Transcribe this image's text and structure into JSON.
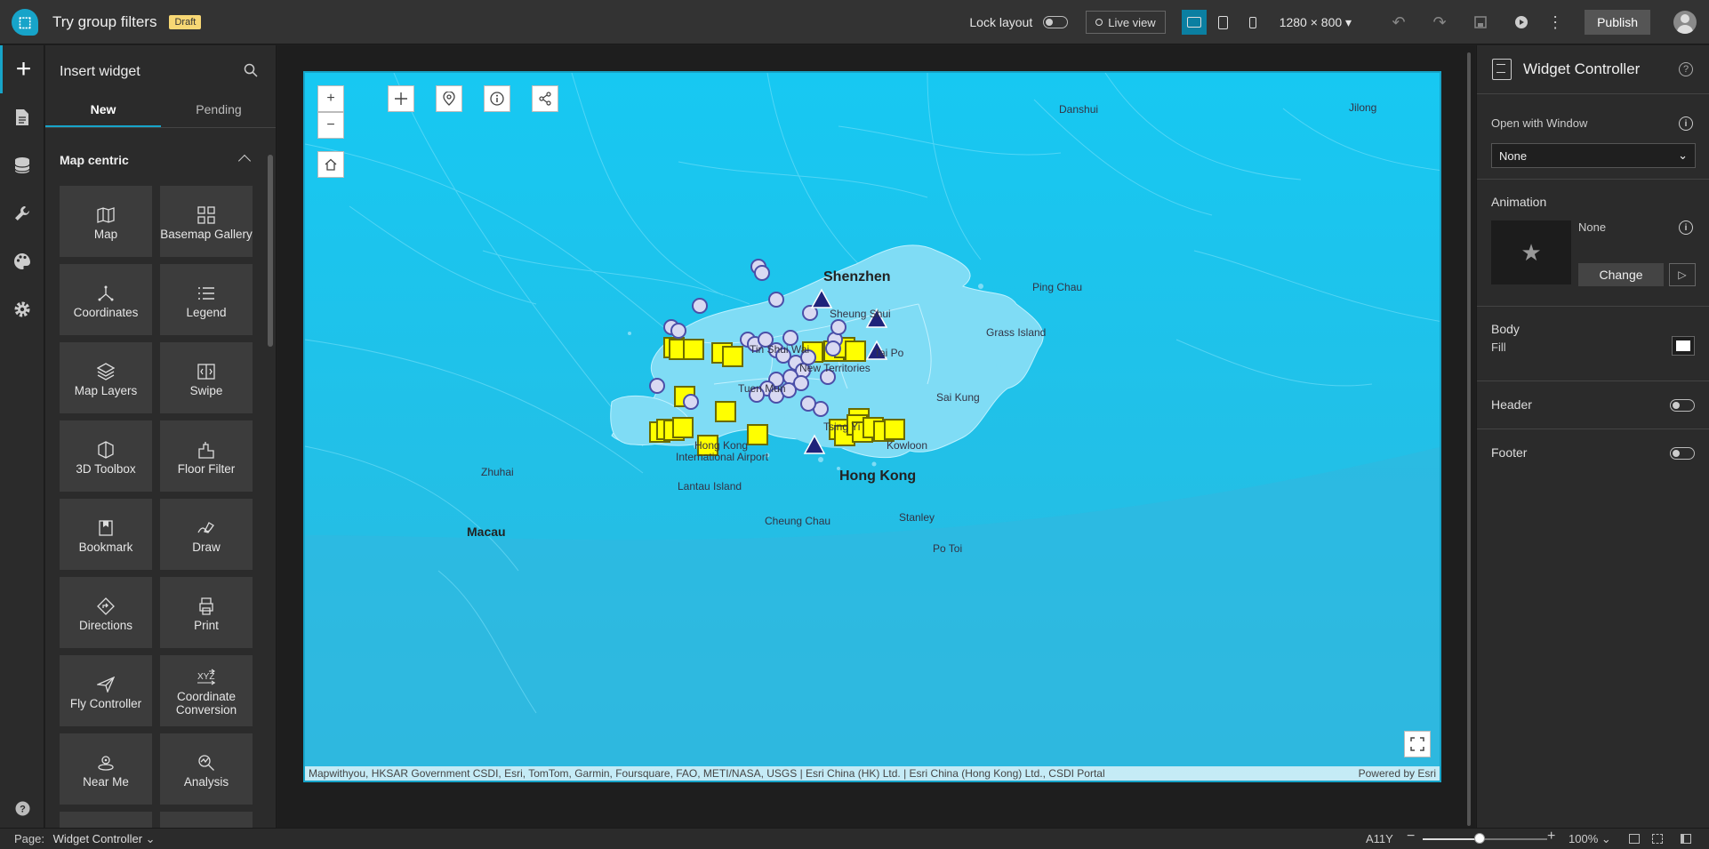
{
  "header": {
    "app_title": "Try group filters",
    "draft_badge": "Draft",
    "lock_layout_label": "Lock layout",
    "lock_layout_on": false,
    "live_view_label": "Live view",
    "resolution": "1280 × 800",
    "publish_label": "Publish",
    "icons": [
      "undo-icon",
      "redo-icon",
      "save-icon",
      "preview-icon",
      "more-icon"
    ]
  },
  "rail": {
    "items": [
      "add-icon",
      "page-icon",
      "data-icon",
      "tools-icon",
      "theme-icon",
      "settings-icon"
    ],
    "help": "?"
  },
  "insert_panel": {
    "title": "Insert widget",
    "tabs": [
      {
        "label": "New",
        "active": true
      },
      {
        "label": "Pending",
        "active": false
      }
    ],
    "section": "Map centric",
    "widgets": [
      {
        "label": "Map",
        "icon": "map-icon"
      },
      {
        "label": "Basemap Gallery",
        "icon": "basemap-gallery-icon"
      },
      {
        "label": "Coordinates",
        "icon": "coordinates-icon"
      },
      {
        "label": "Legend",
        "icon": "legend-icon"
      },
      {
        "label": "Map Layers",
        "icon": "map-layers-icon"
      },
      {
        "label": "Swipe",
        "icon": "swipe-icon"
      },
      {
        "label": "3D Toolbox",
        "icon": "3d-toolbox-icon"
      },
      {
        "label": "Floor Filter",
        "icon": "floor-filter-icon"
      },
      {
        "label": "Bookmark",
        "icon": "bookmark-icon"
      },
      {
        "label": "Draw",
        "icon": "draw-icon"
      },
      {
        "label": "Directions",
        "icon": "directions-icon"
      },
      {
        "label": "Print",
        "icon": "print-icon"
      },
      {
        "label": "Fly Controller",
        "icon": "fly-controller-icon"
      },
      {
        "label": "Coordinate Conversion",
        "icon": "coordinate-conversion-icon"
      },
      {
        "label": "Near Me",
        "icon": "near-me-icon"
      },
      {
        "label": "Analysis",
        "icon": "analysis-icon"
      }
    ]
  },
  "map": {
    "zoom_in": "+",
    "zoom_out": "−",
    "places": {
      "shenzhen": "Shenzhen",
      "hong_kong": "Hong Kong",
      "macau": "Macau",
      "zhuhai": "Zhuhai",
      "danshui": "Danshui",
      "jilong": "Jilong",
      "ping_chau": "Ping Chau",
      "grass_island": "Grass Island",
      "sheung_shui": "Sheung Shui",
      "tin_shui_wai": "Tin Shui Wai",
      "tai_po": "Tai Po",
      "new_territories": "New Territories",
      "tuen_mun": "Tuen Mun",
      "sai_kung": "Sai Kung",
      "tsing_yi": "Tsing Yi",
      "kowloon": "Kowloon",
      "hk_airport_1": "Hong Kong",
      "hk_airport_2": "International Airport",
      "lantau_island": "Lantau Island",
      "cheung_chau": "Cheung Chau",
      "stanley": "Stanley",
      "po_toi": "Po Toi"
    },
    "attribution": "Mapwithyou, HKSAR Government CSDI, Esri, TomTom, Garmin, Foursquare, FAO, METI/NASA, USGS | Esri China (HK) Ltd. | Esri China (Hong Kong) Ltd., CSDI Portal",
    "powered_by": "Powered by Esri"
  },
  "right_panel": {
    "title": "Widget Controller",
    "open_with_window_label": "Open with Window",
    "open_with_window_value": "None",
    "animation_label": "Animation",
    "animation_value": "None",
    "change_label": "Change",
    "body_label": "Body",
    "fill_label": "Fill",
    "fill_color": "#ffffff",
    "header_label": "Header",
    "header_on": false,
    "footer_label": "Footer",
    "footer_on": false
  },
  "footer": {
    "page_label": "Page:",
    "page_value": "Widget Controller",
    "a11y": "A11Y",
    "zoom_value": "100%"
  },
  "colors": {
    "accent": "#17a4c9",
    "map_water": "#18c4ee",
    "hk_land": "#7fdcf5",
    "marker_square": "#ffff00",
    "marker_triangle": "#1f237a",
    "marker_circle": "#d9d9f2"
  }
}
